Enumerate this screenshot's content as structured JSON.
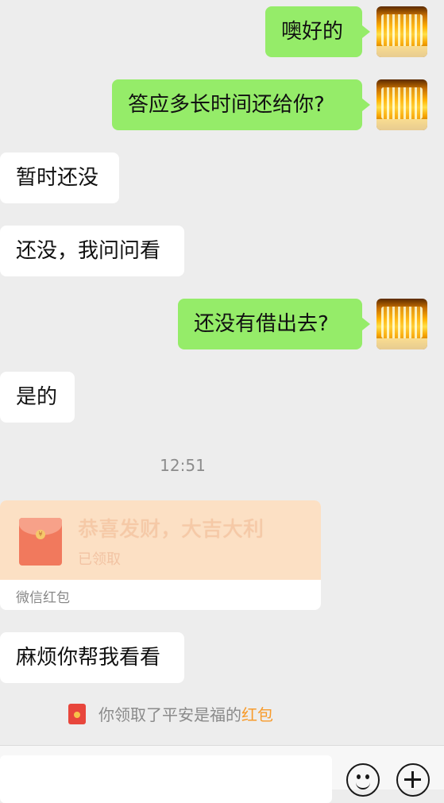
{
  "messages": [
    {
      "side": "out",
      "text": "噢好的"
    },
    {
      "side": "out",
      "text": "答应多长时间还给你?"
    },
    {
      "side": "in",
      "text": "暂时还没"
    },
    {
      "side": "in",
      "text": "还没，我问问看"
    },
    {
      "side": "out",
      "text": "还没有借出去?"
    },
    {
      "side": "in",
      "text": "是的"
    }
  ],
  "timestamp": "12:51",
  "red_packet": {
    "title": "恭喜发财，大吉大利",
    "status": "已领取",
    "label": "微信红包",
    "coin": "¥"
  },
  "last_message": {
    "side": "in",
    "text": "麻烦你帮我看看"
  },
  "system_notice": {
    "prefix": "你领取了平安是福的",
    "link": "红包"
  },
  "icons": {
    "emoji": "emoji-icon",
    "plus": "plus-icon"
  },
  "colors": {
    "outgoing_bubble": "#95ec69",
    "incoming_bubble": "#ffffff",
    "background": "#ededed",
    "red_packet": "#fce0c4",
    "link": "#f79b2c"
  }
}
